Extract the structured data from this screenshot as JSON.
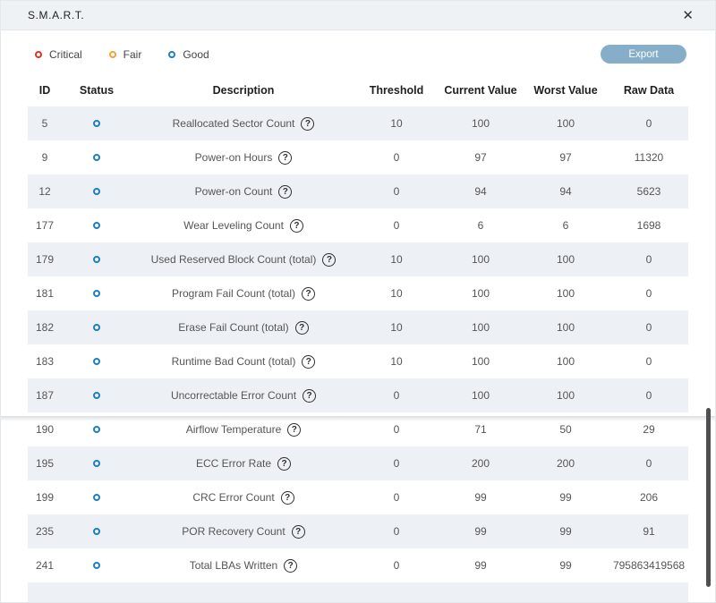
{
  "dialog": {
    "title": "S.M.A.R.T."
  },
  "toolbar": {
    "legend": [
      {
        "label": "Critical",
        "color": "#dd3529"
      },
      {
        "label": "Fair",
        "color": "#f0a33a"
      },
      {
        "label": "Good",
        "color": "#1b7fc4"
      }
    ],
    "export_label": "Export"
  },
  "colors": {
    "status_good": "#1b7fc4",
    "export_button": "#87aec8",
    "row_alt": "#edf1f5",
    "titlebar_bg": "#eef2f5"
  },
  "table": {
    "columns": [
      "ID",
      "Status",
      "Description",
      "Threshold",
      "Current Value",
      "Worst Value",
      "Raw Data"
    ],
    "rows": [
      {
        "id": "5",
        "status": "good",
        "description": "Reallocated Sector Count",
        "threshold": "10",
        "current": "100",
        "worst": "100",
        "raw": "0"
      },
      {
        "id": "9",
        "status": "good",
        "description": "Power-on Hours",
        "threshold": "0",
        "current": "97",
        "worst": "97",
        "raw": "11320"
      },
      {
        "id": "12",
        "status": "good",
        "description": "Power-on Count",
        "threshold": "0",
        "current": "94",
        "worst": "94",
        "raw": "5623"
      },
      {
        "id": "177",
        "status": "good",
        "description": "Wear Leveling Count",
        "threshold": "0",
        "current": "6",
        "worst": "6",
        "raw": "1698"
      },
      {
        "id": "179",
        "status": "good",
        "description": "Used Reserved Block Count (total)",
        "threshold": "10",
        "current": "100",
        "worst": "100",
        "raw": "0"
      },
      {
        "id": "181",
        "status": "good",
        "description": "Program Fail Count (total)",
        "threshold": "10",
        "current": "100",
        "worst": "100",
        "raw": "0"
      },
      {
        "id": "182",
        "status": "good",
        "description": "Erase Fail Count (total)",
        "threshold": "10",
        "current": "100",
        "worst": "100",
        "raw": "0"
      },
      {
        "id": "183",
        "status": "good",
        "description": "Runtime Bad Count (total)",
        "threshold": "10",
        "current": "100",
        "worst": "100",
        "raw": "0"
      },
      {
        "id": "187",
        "status": "good",
        "description": "Uncorrectable Error Count",
        "threshold": "0",
        "current": "100",
        "worst": "100",
        "raw": "0"
      },
      {
        "id": "190",
        "status": "good",
        "description": "Airflow Temperature",
        "threshold": "0",
        "current": "71",
        "worst": "50",
        "raw": "29"
      },
      {
        "id": "195",
        "status": "good",
        "description": "ECC Error Rate",
        "threshold": "0",
        "current": "200",
        "worst": "200",
        "raw": "0"
      },
      {
        "id": "199",
        "status": "good",
        "description": "CRC Error Count",
        "threshold": "0",
        "current": "99",
        "worst": "99",
        "raw": "206"
      },
      {
        "id": "235",
        "status": "good",
        "description": "POR Recovery Count",
        "threshold": "0",
        "current": "99",
        "worst": "99",
        "raw": "91"
      },
      {
        "id": "241",
        "status": "good",
        "description": "Total LBAs Written",
        "threshold": "0",
        "current": "99",
        "worst": "99",
        "raw": "795863419568"
      }
    ]
  }
}
